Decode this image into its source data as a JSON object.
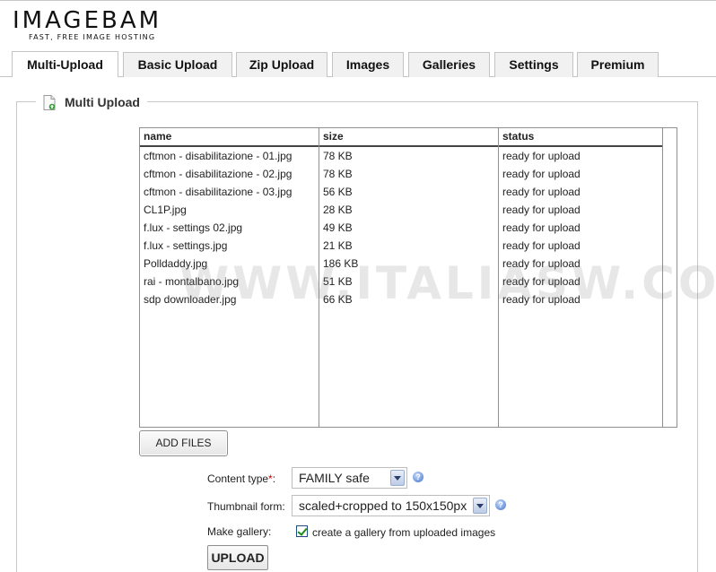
{
  "logo": {
    "name": "IMAGEBAM",
    "tagline": "FAST, FREE IMAGE HOSTING"
  },
  "tabs": [
    {
      "label": "Multi-Upload",
      "active": true
    },
    {
      "label": "Basic Upload",
      "active": false
    },
    {
      "label": "Zip Upload",
      "active": false
    },
    {
      "label": "Images",
      "active": false
    },
    {
      "label": "Galleries",
      "active": false
    },
    {
      "label": "Settings",
      "active": false
    },
    {
      "label": "Premium",
      "active": false
    }
  ],
  "section": {
    "title": "Multi Upload",
    "icon": "document-upload-icon"
  },
  "file_table": {
    "columns": [
      "name",
      "size",
      "status"
    ],
    "rows": [
      {
        "name": "cftmon - disabilitazione - 01.jpg",
        "size": "78 KB",
        "status": "ready for upload"
      },
      {
        "name": "cftmon - disabilitazione - 02.jpg",
        "size": "78 KB",
        "status": "ready for upload"
      },
      {
        "name": "cftmon - disabilitazione - 03.jpg",
        "size": "56 KB",
        "status": "ready for upload"
      },
      {
        "name": "CL1P.jpg",
        "size": "28 KB",
        "status": "ready for upload"
      },
      {
        "name": "f.lux - settings 02.jpg",
        "size": "49 KB",
        "status": "ready for upload"
      },
      {
        "name": "f.lux - settings.jpg",
        "size": "21 KB",
        "status": "ready for upload"
      },
      {
        "name": "Polldaddy.jpg",
        "size": "186 KB",
        "status": "ready for upload"
      },
      {
        "name": "rai - montalbano.jpg",
        "size": "51 KB",
        "status": "ready for upload"
      },
      {
        "name": "sdp downloader.jpg",
        "size": "66 KB",
        "status": "ready for upload"
      }
    ]
  },
  "watermark": "WWW.ITALIASW.COM",
  "buttons": {
    "add_files": "ADD FILES",
    "upload": "UPLOAD"
  },
  "form": {
    "content_type_label": "Content type",
    "content_type_required": "*",
    "content_type_suffix": ":",
    "content_type_value": "FAMILY safe",
    "thumbnail_label": "Thumbnail form:",
    "thumbnail_value": "scaled+cropped to 150x150px",
    "gallery_label": "Make gallery:",
    "gallery_checked": true,
    "gallery_text": "create a gallery from uploaded images",
    "help_glyph": "?"
  },
  "colors": {
    "tab_bg": "#f1f1f1",
    "border": "#c4c4c4",
    "required": "#cc0000",
    "help": "#3f72c8",
    "check": "#1c8a1c"
  }
}
